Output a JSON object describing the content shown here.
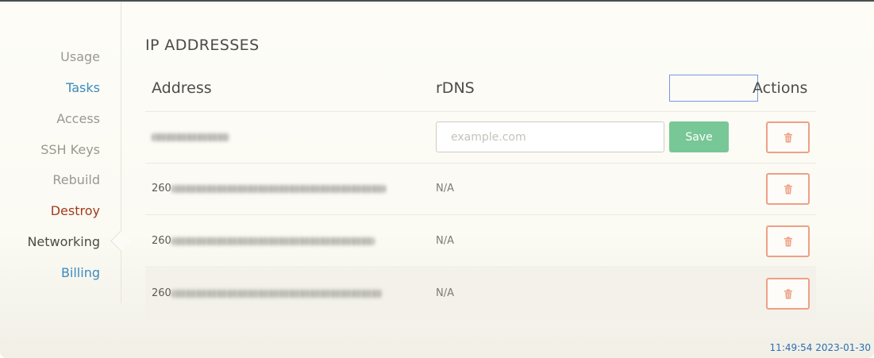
{
  "sidebar": {
    "items": [
      {
        "label": "Usage",
        "style": "muted"
      },
      {
        "label": "Tasks",
        "style": "link"
      },
      {
        "label": "Access",
        "style": "muted"
      },
      {
        "label": "SSH Keys",
        "style": "muted"
      },
      {
        "label": "Rebuild",
        "style": "muted"
      },
      {
        "label": "Destroy",
        "style": "danger"
      },
      {
        "label": "Networking",
        "style": "active"
      },
      {
        "label": "Billing",
        "style": "link"
      }
    ],
    "active_item": "Networking"
  },
  "main": {
    "title": "IP ADDRESSES",
    "columns": {
      "address": "Address",
      "rdns": "rDNS",
      "actions": "Actions"
    },
    "rows": [
      {
        "address_visible": "",
        "rdns": "",
        "rdns_placeholder": "example.com",
        "save_label": "Save",
        "editable": true
      },
      {
        "address_visible": "260",
        "rdns": "N/A",
        "editable": false
      },
      {
        "address_visible": "260",
        "rdns": "N/A",
        "editable": false
      },
      {
        "address_visible": "260",
        "rdns": "N/A",
        "editable": false
      }
    ],
    "delete_icon": "trash-icon"
  },
  "status": {
    "timestamp": "11:49:54 2023-01-30"
  },
  "colors": {
    "link": "#3a8bbf",
    "danger": "#a13b1c",
    "save_button": "#78c796",
    "delete_border": "#eda185",
    "timestamp": "#2d6fb4"
  }
}
